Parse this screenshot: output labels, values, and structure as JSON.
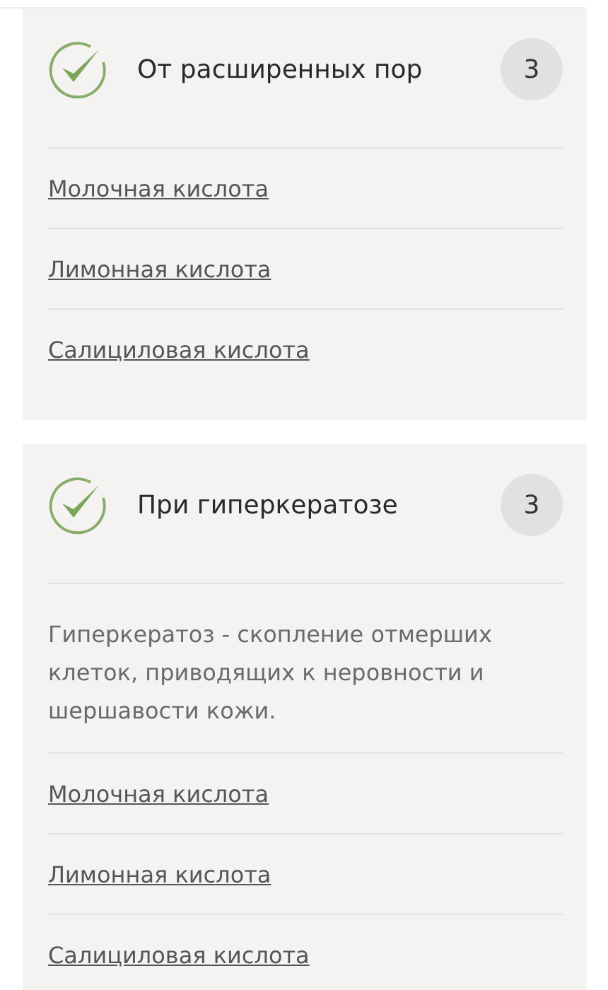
{
  "sections": [
    {
      "title": "От расширенных пор",
      "count": "3",
      "links": [
        "Молочная кислота",
        "Лимонная кислота",
        "Салициловая кислота"
      ]
    },
    {
      "title": "При гиперкератозе",
      "count": "3",
      "description": "Гиперкератоз - скопление отмерших клеток, приводящих к неровности и шершавости кожи.",
      "links": [
        "Молочная кислота",
        "Лимонная кислота",
        "Салициловая кислота"
      ]
    }
  ]
}
